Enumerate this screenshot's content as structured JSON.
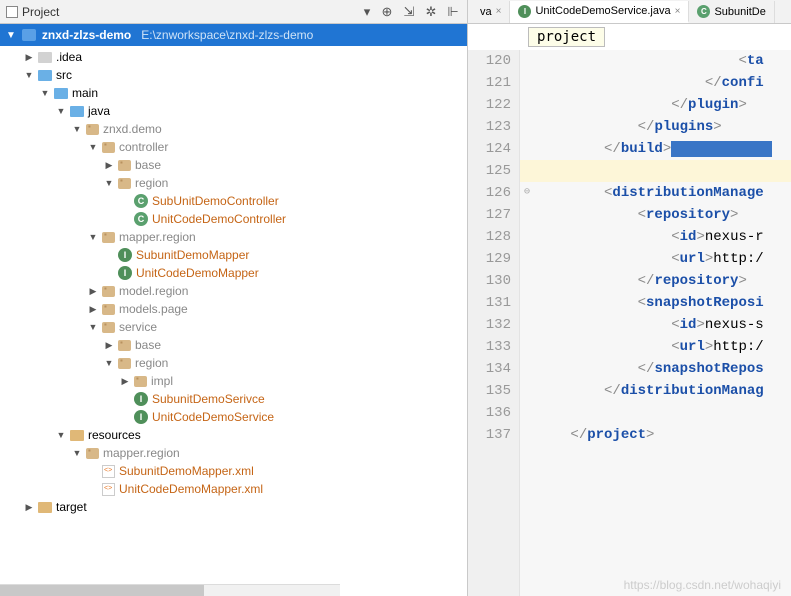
{
  "panel": {
    "title": "Project"
  },
  "root": {
    "name": "znxd-zlzs-demo",
    "path": "E:\\znworkspace\\znxd-zlzs-demo"
  },
  "tree": [
    {
      "d": 1,
      "a": "r",
      "ic": "gray",
      "t": ".idea",
      "cls": ""
    },
    {
      "d": 1,
      "a": "d",
      "ic": "blue",
      "t": "src",
      "cls": ""
    },
    {
      "d": 2,
      "a": "d",
      "ic": "blue",
      "t": "main",
      "cls": ""
    },
    {
      "d": 3,
      "a": "d",
      "ic": "blue",
      "t": "java",
      "cls": ""
    },
    {
      "d": 4,
      "a": "d",
      "ic": "pkg",
      "t": "znxd.demo",
      "cls": "pkgname"
    },
    {
      "d": 5,
      "a": "d",
      "ic": "pkg",
      "t": "controller",
      "cls": "pkgname"
    },
    {
      "d": 6,
      "a": "r",
      "ic": "pkg",
      "t": "base",
      "cls": "pkgname"
    },
    {
      "d": 6,
      "a": "d",
      "ic": "pkg",
      "t": "region",
      "cls": "pkgname"
    },
    {
      "d": 7,
      "a": "",
      "ic": "C",
      "t": "SubUnitDemoController",
      "cls": "orange"
    },
    {
      "d": 7,
      "a": "",
      "ic": "C",
      "t": "UnitCodeDemoController",
      "cls": "orange"
    },
    {
      "d": 5,
      "a": "d",
      "ic": "pkg",
      "t": "mapper.region",
      "cls": "pkgname"
    },
    {
      "d": 6,
      "a": "",
      "ic": "I",
      "t": "SubunitDemoMapper",
      "cls": "orange"
    },
    {
      "d": 6,
      "a": "",
      "ic": "I",
      "t": "UnitCodeDemoMapper",
      "cls": "orange"
    },
    {
      "d": 5,
      "a": "r",
      "ic": "pkg",
      "t": "model.region",
      "cls": "pkgname"
    },
    {
      "d": 5,
      "a": "r",
      "ic": "pkg",
      "t": "models.page",
      "cls": "pkgname"
    },
    {
      "d": 5,
      "a": "d",
      "ic": "pkg",
      "t": "service",
      "cls": "pkgname"
    },
    {
      "d": 6,
      "a": "r",
      "ic": "pkg",
      "t": "base",
      "cls": "pkgname"
    },
    {
      "d": 6,
      "a": "d",
      "ic": "pkg",
      "t": "region",
      "cls": "pkgname"
    },
    {
      "d": 7,
      "a": "r",
      "ic": "pkg",
      "t": "impl",
      "cls": "pkgname"
    },
    {
      "d": 7,
      "a": "",
      "ic": "I",
      "t": "SubunitDemoSerivce",
      "cls": "orange"
    },
    {
      "d": 7,
      "a": "",
      "ic": "I",
      "t": "UnitCodeDemoService",
      "cls": "orange"
    },
    {
      "d": 3,
      "a": "d",
      "ic": "tan",
      "t": "resources",
      "cls": ""
    },
    {
      "d": 4,
      "a": "d",
      "ic": "pkg",
      "t": "mapper.region",
      "cls": "pkgname"
    },
    {
      "d": 5,
      "a": "",
      "ic": "xml",
      "t": "SubunitDemoMapper.xml",
      "cls": "orange"
    },
    {
      "d": 5,
      "a": "",
      "ic": "xml",
      "t": "UnitCodeDemoMapper.xml",
      "cls": "orange"
    },
    {
      "d": 1,
      "a": "r",
      "ic": "tan",
      "t": "target",
      "cls": ""
    }
  ],
  "tabs": [
    {
      "label": "va",
      "icon": "",
      "close": true
    },
    {
      "label": "UnitCodeDemoService.java",
      "icon": "I",
      "close": true
    },
    {
      "label": "SubunitDe",
      "icon": "C",
      "close": false
    }
  ],
  "crumb": "project",
  "lines_start": 120,
  "code": [
    {
      "html": "                        <span class='tg'>&lt;</span><span class='kw'>ta</span>"
    },
    {
      "html": "                    <span class='tg'>&lt;/</span><span class='kw'>confi</span>"
    },
    {
      "html": "                <span class='tg'>&lt;/</span><span class='kw'>plugin</span><span class='tg'>&gt;</span>"
    },
    {
      "html": "            <span class='tg'>&lt;/</span><span class='kw'>plugins</span><span class='tg'>&gt;</span>"
    },
    {
      "html": "        <span class='tg'>&lt;/</span><span class='kw'>build</span><span class='tg'>&gt;</span><span class='sel'>            </span>",
      "sel": true
    },
    {
      "html": "",
      "hl": true
    },
    {
      "html": "        <span class='tg'>&lt;</span><span class='kw'>distributionManage</span>",
      "fold": "⊖"
    },
    {
      "html": "            <span class='tg'>&lt;</span><span class='kw'>repository</span><span class='tg'>&gt;</span>"
    },
    {
      "html": "                <span class='tg'>&lt;</span><span class='kw'>id</span><span class='tg'>&gt;</span>nexus-r"
    },
    {
      "html": "                <span class='tg'>&lt;</span><span class='kw'>url</span><span class='tg'>&gt;</span>http:/"
    },
    {
      "html": "            <span class='tg'>&lt;/</span><span class='kw'>repository</span><span class='tg'>&gt;</span>"
    },
    {
      "html": "            <span class='tg'>&lt;</span><span class='kw'>snapshotReposi</span>"
    },
    {
      "html": "                <span class='tg'>&lt;</span><span class='kw'>id</span><span class='tg'>&gt;</span>nexus-s"
    },
    {
      "html": "                <span class='tg'>&lt;</span><span class='kw'>url</span><span class='tg'>&gt;</span>http:/"
    },
    {
      "html": "            <span class='tg'>&lt;/</span><span class='kw'>snapshotRepos</span>"
    },
    {
      "html": "        <span class='tg'>&lt;/</span><span class='kw'>distributionManag</span>"
    },
    {
      "html": ""
    },
    {
      "html": "    <span class='tg'>&lt;/</span><span class='kw'>project</span><span class='tg'>&gt;</span>"
    }
  ],
  "watermark": "https://blog.csdn.net/wohaqiyi"
}
